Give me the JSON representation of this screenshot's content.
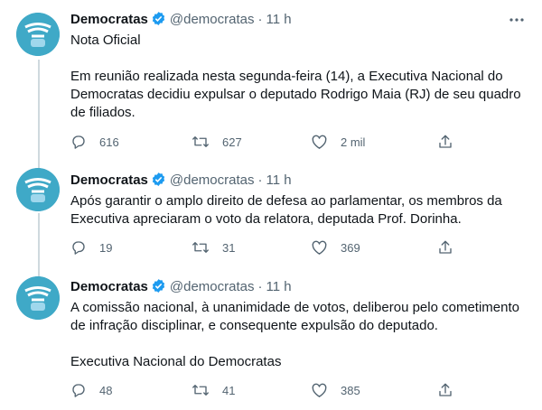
{
  "tweets": [
    {
      "display_name": "Democratas",
      "handle": "@democratas",
      "separator": "·",
      "time": "11 h",
      "lines": [
        "Nota Oficial",
        "",
        "Em reunião realizada nesta segunda-feira (14), a Executiva Nacional do",
        "Democratas decidiu expulsar o deputado Rodrigo Maia (RJ) de seu quadro",
        "de filiados."
      ],
      "replies": "616",
      "retweets": "627",
      "likes": "2 mil"
    },
    {
      "display_name": "Democratas",
      "handle": "@democratas",
      "separator": "·",
      "time": "11 h",
      "lines": [
        "Após garantir o amplo direito de defesa ao parlamentar, os membros da",
        "Executiva apreciaram o voto da relatora, deputada Prof. Dorinha."
      ],
      "replies": "19",
      "retweets": "31",
      "likes": "369"
    },
    {
      "display_name": "Democratas",
      "handle": "@democratas",
      "separator": "·",
      "time": "11 h",
      "lines": [
        "A comissão nacional, à unanimidade de votos, deliberou pelo cometimento",
        "de infração disciplinar, e consequente expulsão do deputado.",
        "",
        "Executiva Nacional do Democratas"
      ],
      "replies": "48",
      "retweets": "41",
      "likes": "385"
    }
  ],
  "icons": [
    "verified-icon",
    "more-icon",
    "reply-icon",
    "retweet-icon",
    "like-icon",
    "share-icon"
  ],
  "colors": {
    "verified": "#1d9bf0",
    "avatar": "#3fa9c7",
    "muted": "#536471",
    "thread_line": "#cfd9de"
  }
}
